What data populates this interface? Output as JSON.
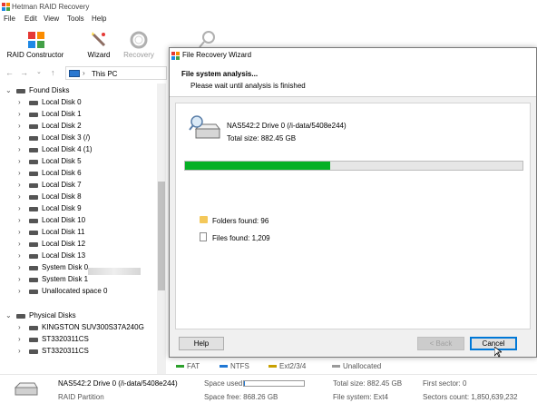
{
  "app": {
    "title": "Hetman RAID Recovery"
  },
  "menu": [
    "File",
    "Edit",
    "View",
    "Tools",
    "Help"
  ],
  "toolbar": {
    "raid_constructor": "RAID Constructor",
    "wizard": "Wizard",
    "recovery": "Recovery"
  },
  "address": {
    "location": "This PC"
  },
  "tree": {
    "found_disks_label": "Found Disks",
    "found_disks": [
      "Local Disk 0",
      "Local Disk 1",
      "Local Disk 2",
      "Local Disk 3 (/)",
      "Local Disk 4 (1)",
      "Local Disk 5",
      "Local Disk 6",
      "Local Disk 7",
      "Local Disk 8",
      "Local Disk 9",
      "Local Disk 10",
      "Local Disk 11",
      "Local Disk 12",
      "Local Disk 13",
      "System Disk 0",
      "System Disk 1",
      "Unallocated space 0"
    ],
    "physical_disks_label": "Physical Disks",
    "physical_disks": [
      "KINGSTON SUV300S37A240G",
      "ST3320311CS",
      "ST3320311CS"
    ]
  },
  "dialog": {
    "title": "File Recovery Wizard",
    "heading": "File system analysis...",
    "subheading": "Please wait until analysis is finished",
    "drive_name": "NAS542:2 Drive 0 (/i-data/5408e244)",
    "total_size": "Total size: 882.45 GB",
    "progress": 0.43,
    "folders_found": "Folders found: 96",
    "files_found": "Files found: 1,209",
    "help": "Help",
    "back": "< Back",
    "cancel": "Cancel"
  },
  "legend": {
    "items": [
      {
        "label": "FAT",
        "color": "#2ca02c"
      },
      {
        "label": "NTFS",
        "color": "#1f77d4"
      },
      {
        "label": "Ext2/3/4",
        "color": "#c8a000"
      },
      {
        "label": "Unallocated",
        "color": "#9a9a9a"
      }
    ]
  },
  "status": {
    "name": "NAS542:2 Drive 0 (/i-data/5408e244)",
    "type": "RAID Partition",
    "space_used_label": "Space used:",
    "space_used_fraction": 0.02,
    "space_free": "Space free: 868.26 GB",
    "total_size": "Total size: 882.45 GB",
    "file_system": "File system: Ext4",
    "first_sector": "First sector: 0",
    "sectors_count": "Sectors count: 1,850,639,232"
  },
  "colors": {
    "progress": "#06b025",
    "accent": "#0078d7"
  }
}
